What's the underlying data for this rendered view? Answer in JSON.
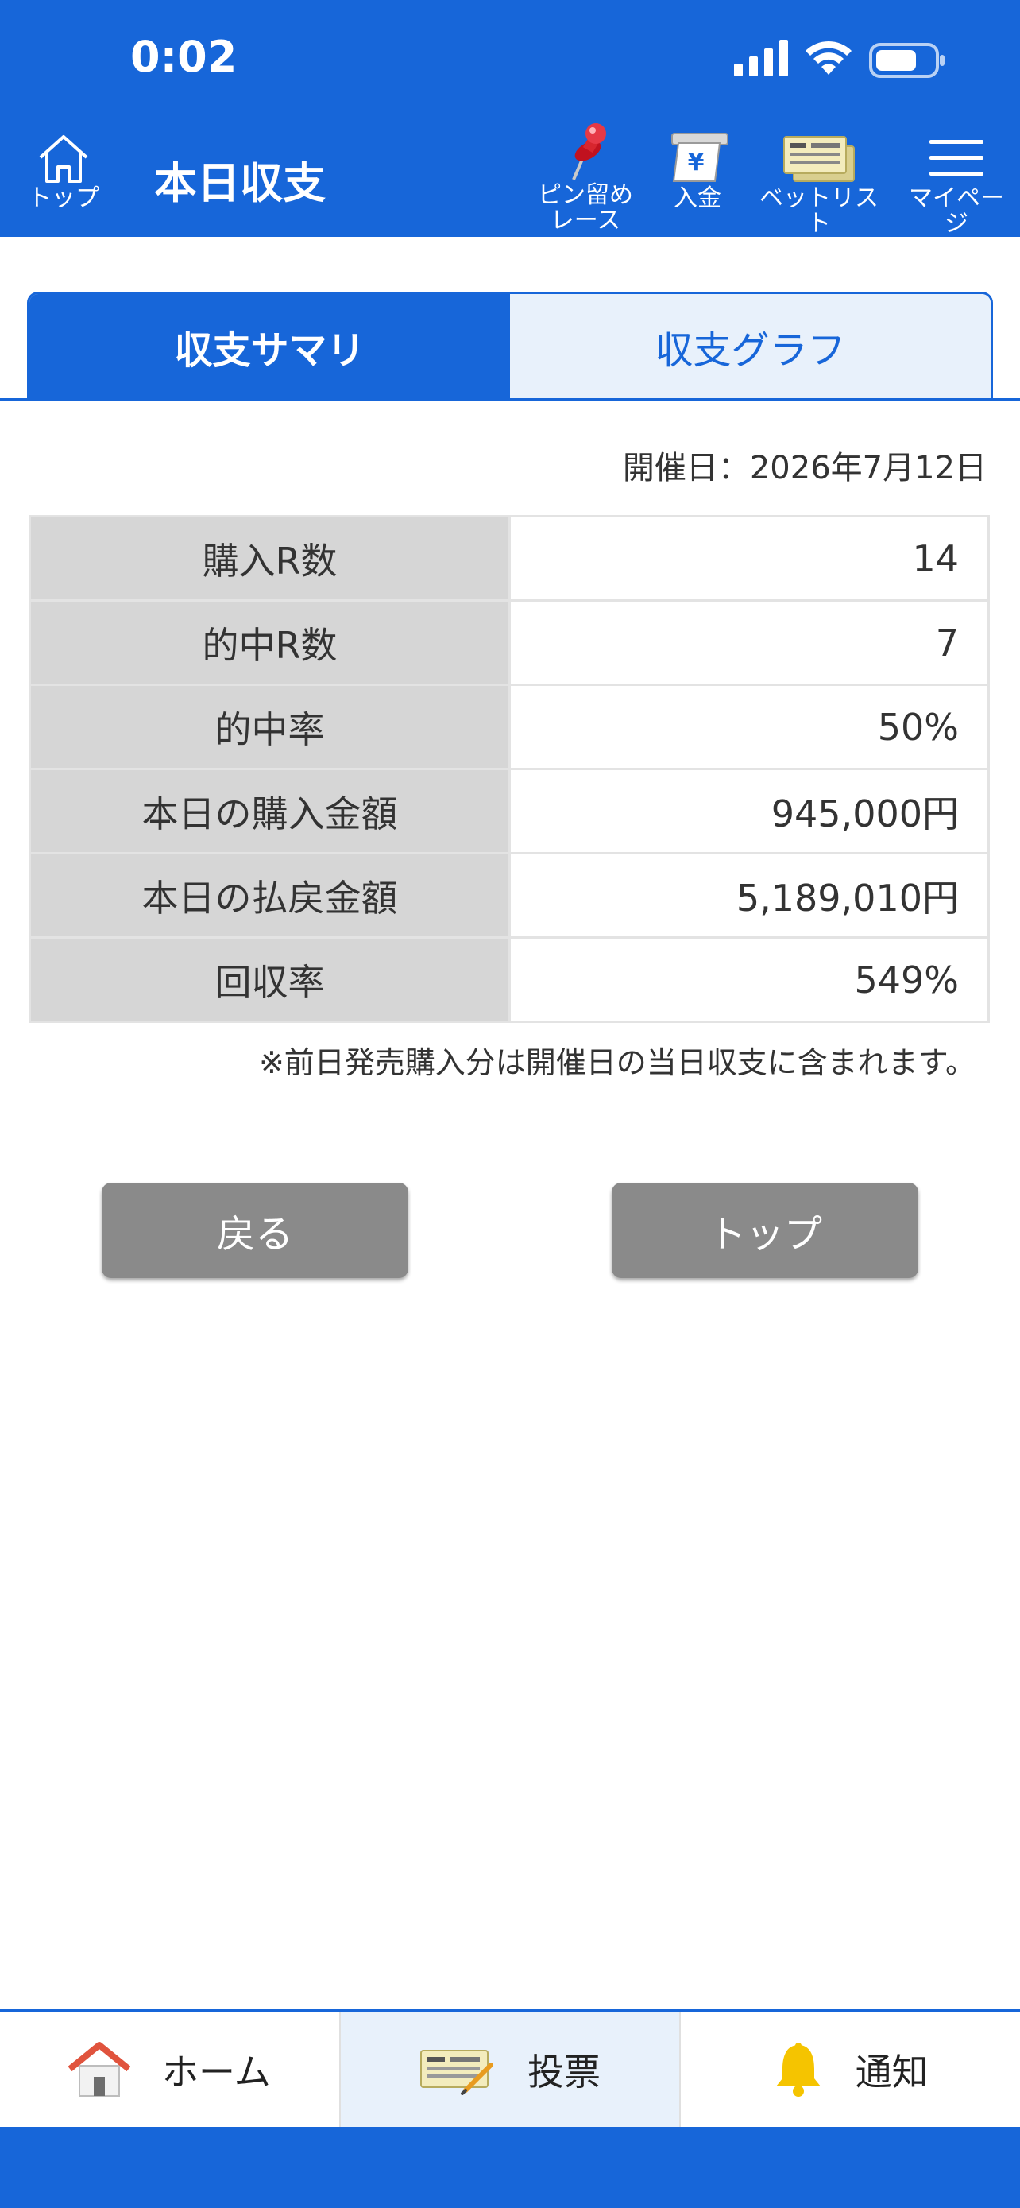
{
  "status": {
    "time": "0:02"
  },
  "header": {
    "home_label": "トップ",
    "title": "本日収支",
    "pin_label_1": "ピン留め",
    "pin_label_2": "レース",
    "deposit_label": "入金",
    "betlist_label": "ベットリスト",
    "mypage_label": "マイページ",
    "yen_glyph": "¥"
  },
  "tabs": [
    {
      "label": "収支サマリ",
      "active": true
    },
    {
      "label": "収支グラフ",
      "active": false
    }
  ],
  "date_label": "開催日：2026年7月12日",
  "summary": {
    "rows": [
      {
        "label": "購入R数",
        "value": "14"
      },
      {
        "label": "的中R数",
        "value": "7"
      },
      {
        "label": "的中率",
        "value": "50%"
      },
      {
        "label": "本日の購入金額",
        "value": "945,000円"
      },
      {
        "label": "本日の払戻金額",
        "value": "5,189,010円"
      },
      {
        "label": "回収率",
        "value": "549%"
      }
    ]
  },
  "note": "※前日発売購入分は開催日の当日収支に含まれます。",
  "buttons": {
    "back": "戻る",
    "top": "トップ"
  },
  "bottom_nav": [
    {
      "label": "ホーム",
      "icon": "house-icon"
    },
    {
      "label": "投票",
      "icon": "ticket-pen-icon",
      "active": true
    },
    {
      "label": "通知",
      "icon": "bell-icon"
    }
  ],
  "colors": {
    "primary": "#1766d9",
    "tab_inactive_bg": "#e8f1fb",
    "key_cell_bg": "#d6d6d6",
    "button_gray": "#8a8a8a"
  }
}
